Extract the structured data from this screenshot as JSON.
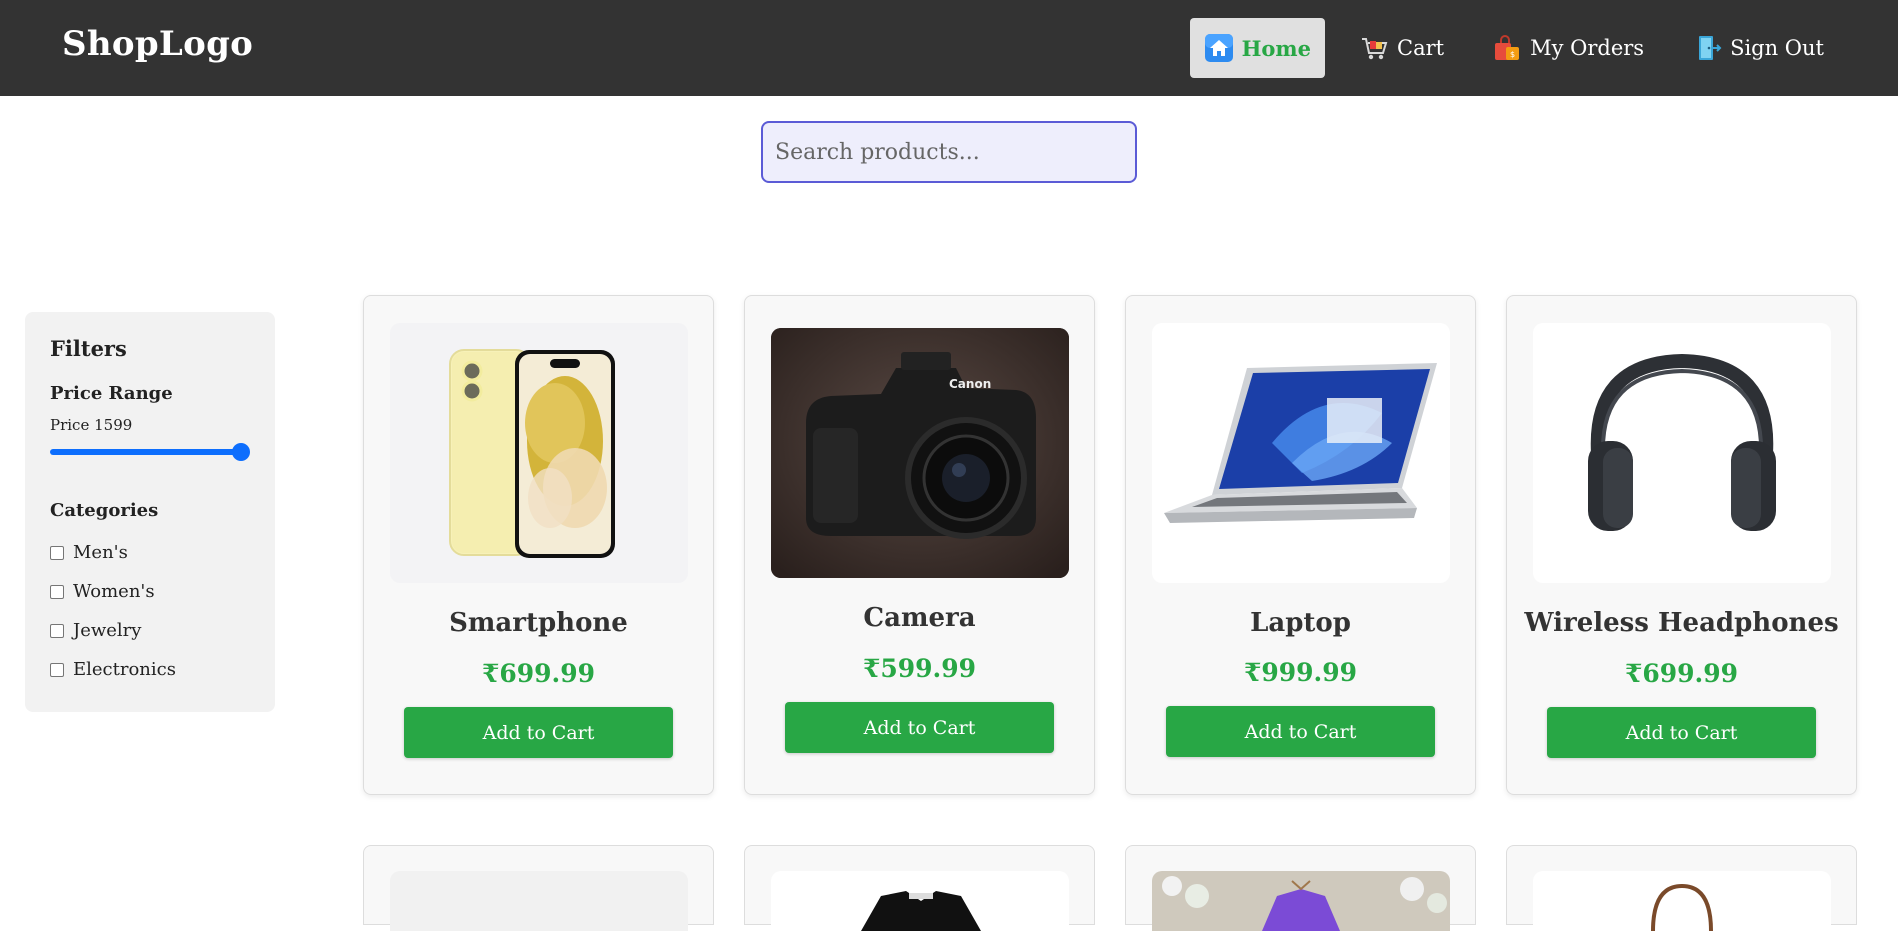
{
  "header": {
    "logo": "ShopLogo",
    "nav": [
      {
        "label": "Home",
        "icon": "home-icon",
        "active": true
      },
      {
        "label": "Cart",
        "icon": "cart-icon",
        "active": false
      },
      {
        "label": "My Orders",
        "icon": "shopping-bag-icon",
        "active": false
      },
      {
        "label": "Sign Out",
        "icon": "sign-out-icon",
        "active": false
      }
    ]
  },
  "search": {
    "placeholder": "Search products...",
    "value": ""
  },
  "filters": {
    "title": "Filters",
    "price_range_label": "Price Range",
    "price_text": "Price 1599",
    "price_value_fraction": 1.0,
    "categories_label": "Categories",
    "categories": [
      "Men's",
      "Women's",
      "Jewelry",
      "Electronics"
    ]
  },
  "products": [
    {
      "name": "Smartphone",
      "price": "₹699.99",
      "button": "Add to Cart",
      "image": "smartphone-image"
    },
    {
      "name": "Camera",
      "price": "₹599.99",
      "button": "Add to Cart",
      "image": "camera-image"
    },
    {
      "name": "Laptop",
      "price": "₹999.99",
      "button": "Add to Cart",
      "image": "laptop-image"
    },
    {
      "name": "Wireless Headphones",
      "price": "₹699.99",
      "button": "Add to Cart",
      "image": "headphones-image"
    }
  ],
  "colors": {
    "navbar": "#333333",
    "accent_green": "#28a745",
    "slider_blue": "#0d6efd",
    "search_border": "#5b5bd6"
  }
}
